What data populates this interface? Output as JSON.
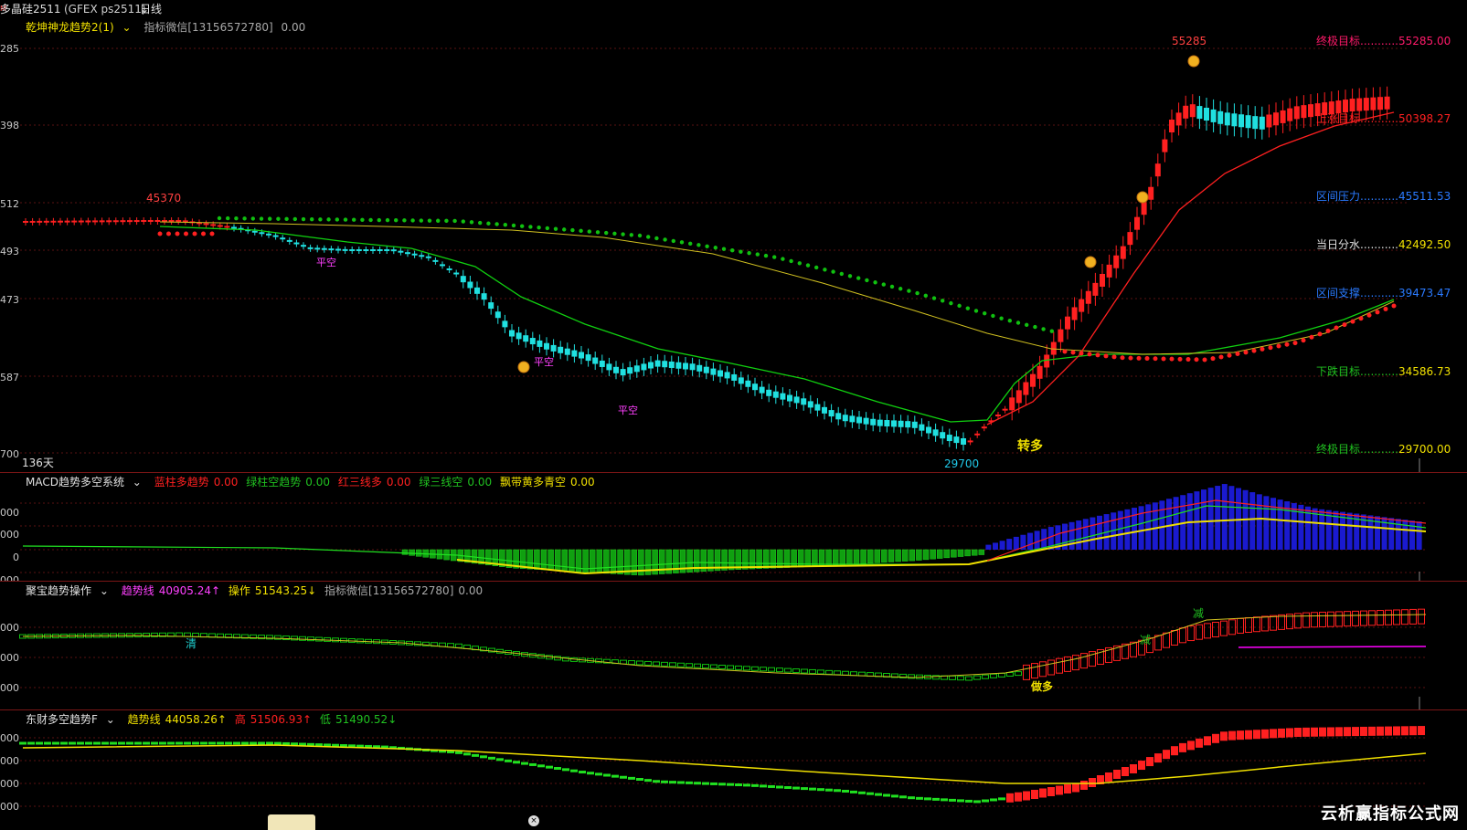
{
  "topbar": {
    "symbol": "多晶硅2511",
    "symbol_mark": "M",
    "exchange": "(GFEX ps2511)",
    "period": "日线"
  },
  "colors": {
    "up": "#ff2020",
    "down": "#20e0e0",
    "green": "#10c010",
    "yellow": "#f0e000",
    "magenta": "#ff00ff",
    "blue": "#1a1acf",
    "grid": "#5a1212"
  },
  "pane1": {
    "indicator": "乾坤神龙趋势2(1)",
    "wechat": "指标微信[13156572780]",
    "wechat_val": "0.00",
    "y_labels": [
      "285",
      "398",
      "512",
      "493",
      "473",
      "587",
      "700"
    ],
    "day_count": "136天",
    "peak_label": "45370",
    "high_label": "55285",
    "low_label": "29700",
    "turn_label": "转多",
    "pingkong": [
      "平空",
      "平空",
      "平空"
    ],
    "levels": [
      {
        "name": "终极目标",
        "value": "55285.00",
        "color": "#ff1a6a"
      },
      {
        "name": "上涨目标",
        "value": "50398.27",
        "color": "#ff2020"
      },
      {
        "name": "区间压力",
        "value": "45511.53",
        "color": "#2a7aff"
      },
      {
        "name": "当日分水",
        "value": "42492.50",
        "color": "#e0e0e0"
      },
      {
        "name": "区间支撑",
        "value": "39473.47",
        "color": "#2a7aff"
      },
      {
        "name": "下跌目标",
        "value": "34586.73",
        "color": "#20c020"
      },
      {
        "name": "终极目标",
        "value": "29700.00",
        "color": "#20c020"
      }
    ]
  },
  "pane2": {
    "indicator": "MACD趋势多空系统",
    "items": [
      {
        "name": "蓝柱多趋势",
        "value": "0.00",
        "color": "#ff2020"
      },
      {
        "name": "绿柱空趋势",
        "value": "0.00",
        "color": "#20c020"
      },
      {
        "name": "红三线多",
        "value": "0.00",
        "color": "#ff2020"
      },
      {
        "name": "绿三线空",
        "value": "0.00",
        "color": "#20c020"
      },
      {
        "name": "飘带黄多青空",
        "value": "0.00",
        "color": "#f0e000"
      }
    ],
    "y_labels": [
      "000",
      "000",
      "0",
      "000"
    ]
  },
  "pane3": {
    "indicator": "聚宝趋势操作",
    "trend_name": "趋势线",
    "trend_value": "40905.24↑",
    "op_name": "操作",
    "op_value": "51543.25↓",
    "wechat": "指标微信[13156572780]",
    "wechat_val": "0.00",
    "y_labels": [
      "000",
      "000",
      "000"
    ],
    "qing": "清",
    "jian": "减",
    "zuoduo": "做多"
  },
  "pane4": {
    "indicator": "东财多空趋势F",
    "trend_name": "趋势线",
    "trend_value": "44058.26↑",
    "high_name": "高",
    "high_value": "51506.93↑",
    "low_name": "低",
    "low_value": "51490.52↓",
    "y_labels": [
      "000",
      "000",
      "000",
      "000"
    ]
  },
  "watermark": "云析赢指标公式网",
  "close_glyph": "×"
}
